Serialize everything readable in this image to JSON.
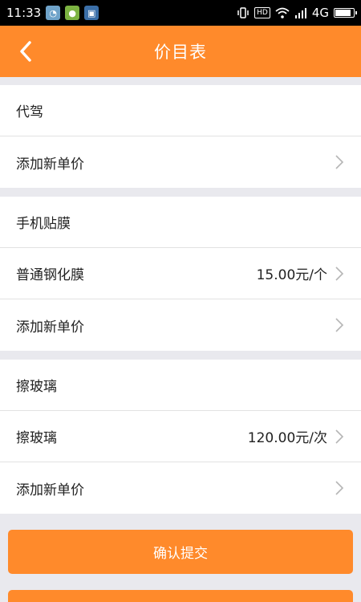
{
  "status_bar": {
    "time": "11:33",
    "network": "4G",
    "hd": "HD"
  },
  "header": {
    "title": "价目表"
  },
  "sections": [
    {
      "title": "代驾",
      "add_label": "添加新单价"
    },
    {
      "title": "手机贴膜",
      "item_label": "普通钢化膜",
      "item_price": "15.00元/个",
      "add_label": "添加新单价"
    },
    {
      "title": "擦玻璃",
      "item_label": "擦玻璃",
      "item_price": "120.00元/次",
      "add_label": "添加新单价"
    }
  ],
  "footer": {
    "confirm_label": "确认提交"
  },
  "colors": {
    "accent": "#ff8a2b",
    "background": "#e9e9ee"
  }
}
